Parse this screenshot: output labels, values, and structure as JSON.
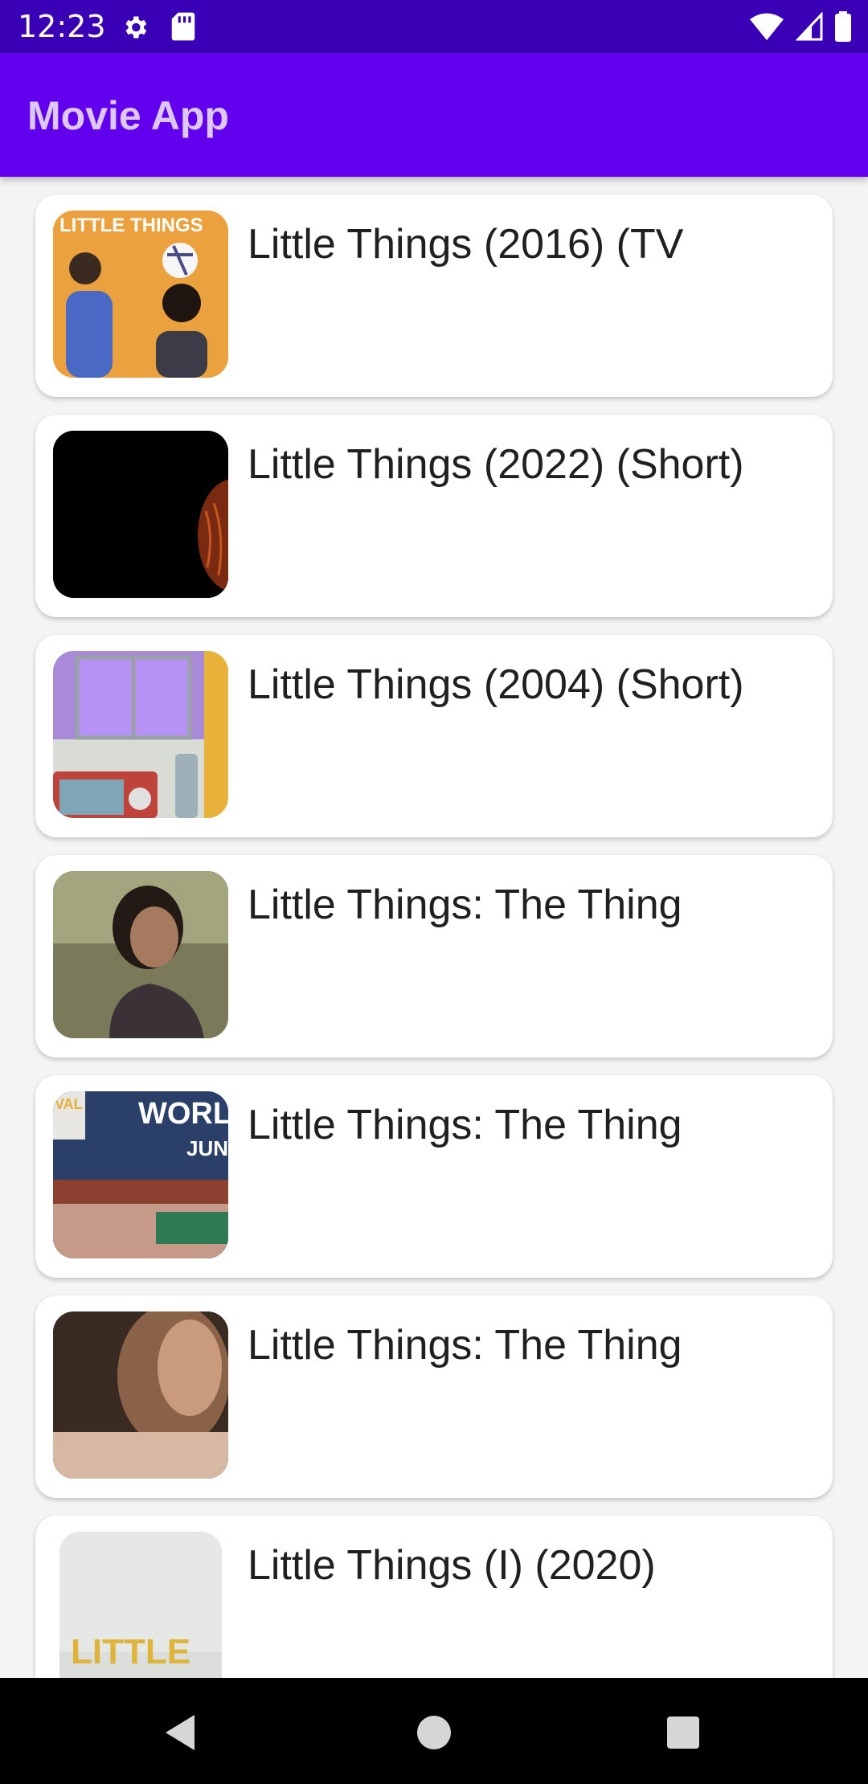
{
  "status_bar": {
    "time": "12:23",
    "icons": [
      "gear-icon",
      "sd-card-icon",
      "wifi-icon",
      "signal-icon",
      "battery-icon"
    ],
    "background": "#3a00b5"
  },
  "app_bar": {
    "title": "Movie App",
    "background": "#6200ee",
    "title_color": "#dcc8ff"
  },
  "movies": [
    {
      "title": "Little Things (2016) (TV",
      "poster_text": "LITTLE THINGS"
    },
    {
      "title": "Little Things (2022) (Short)"
    },
    {
      "title": "Little Things (2004) (Short)"
    },
    {
      "title": "Little Things: The Thing"
    },
    {
      "title": "Little Things: The Thing",
      "poster_text": "WORLD",
      "poster_subtext": "JUNE",
      "poster_corner": "VAL"
    },
    {
      "title": "Little Things: The Thing"
    },
    {
      "title": "Little Things (I) (2020)",
      "poster_text": "LITTLE"
    }
  ],
  "nav_bar": {
    "buttons": [
      "back-icon",
      "home-icon",
      "recents-icon"
    ]
  }
}
